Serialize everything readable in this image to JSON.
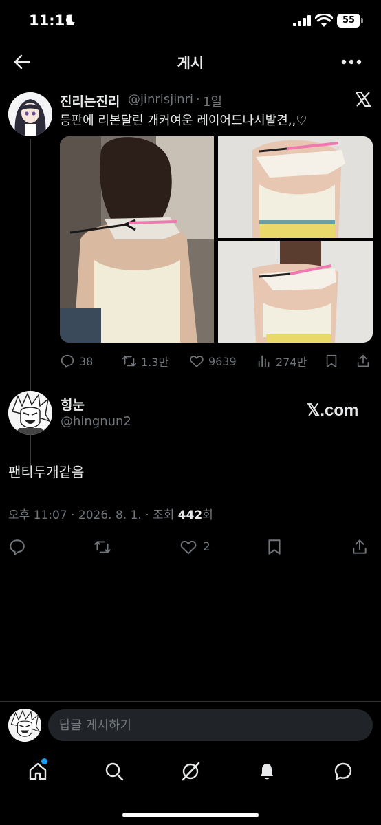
{
  "status_bar": {
    "time": "11:11",
    "battery": "55"
  },
  "header": {
    "title": "게시"
  },
  "quoted_tweet": {
    "name": "진리는진리",
    "handle": "@jinrisjinri",
    "separator": "·",
    "time": "1일",
    "text": "등판에 리본달린 개커여운 레이어드나시발견,,♡",
    "actions": {
      "replies": "38",
      "retweets": "1.3만",
      "likes": "9639",
      "views": "274만"
    }
  },
  "reply": {
    "name": "힝눈",
    "handle": "@hingnun2",
    "watermark": "𝕏.com",
    "text": "팬티두개같음",
    "meta_prefix": "오후 11:07 · 2026. 8. 1. · 조회 ",
    "views": "442",
    "meta_suffix": "회",
    "likes": "2"
  },
  "composer": {
    "placeholder": "답글 게시하기"
  },
  "colors": {
    "accent": "#1d9bf0",
    "muted": "#71767b",
    "text": "#e7e9ea",
    "background": "#000000"
  },
  "icons": [
    "moon-icon",
    "signal-icon",
    "wifi-icon",
    "battery-icon",
    "back-arrow-icon",
    "more-icon",
    "x-logo-icon",
    "reply-icon",
    "retweet-icon",
    "like-icon",
    "views-icon",
    "bookmark-icon",
    "share-icon",
    "home-icon",
    "search-icon",
    "grok-icon",
    "bell-icon",
    "messages-icon"
  ]
}
